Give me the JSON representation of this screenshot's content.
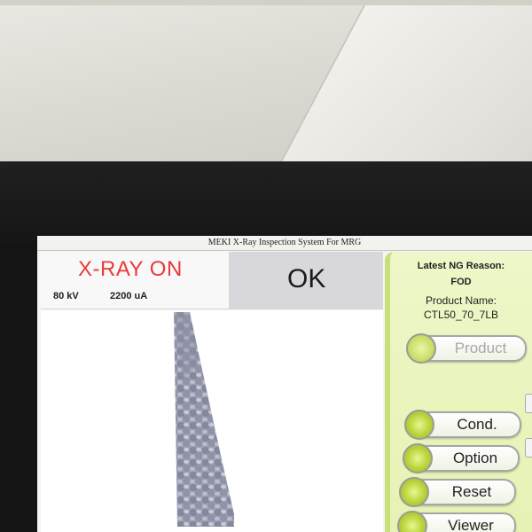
{
  "window": {
    "title": "MEKI X-Ray Inspection System For MRG"
  },
  "status": {
    "xray_state": "X-RAY ON",
    "voltage": "80 kV",
    "current": "2200 uA",
    "result": "OK"
  },
  "panel": {
    "ng_reason_label": "Latest NG Reason:",
    "ng_reason_value": "FOD",
    "product_name_label": "Product Name:",
    "product_name_value": "CTL50_70_7LB",
    "buttons": {
      "product": "Product",
      "cond": "Cond.",
      "option": "Option",
      "reset": "Reset",
      "viewer": "Viewer"
    }
  },
  "colors": {
    "xray_on": "#e83a3a",
    "panel_bg": "#e6f2b4",
    "button_lamp": "#b9d43a"
  },
  "icons": [
    "lamp-indicator-icon"
  ]
}
